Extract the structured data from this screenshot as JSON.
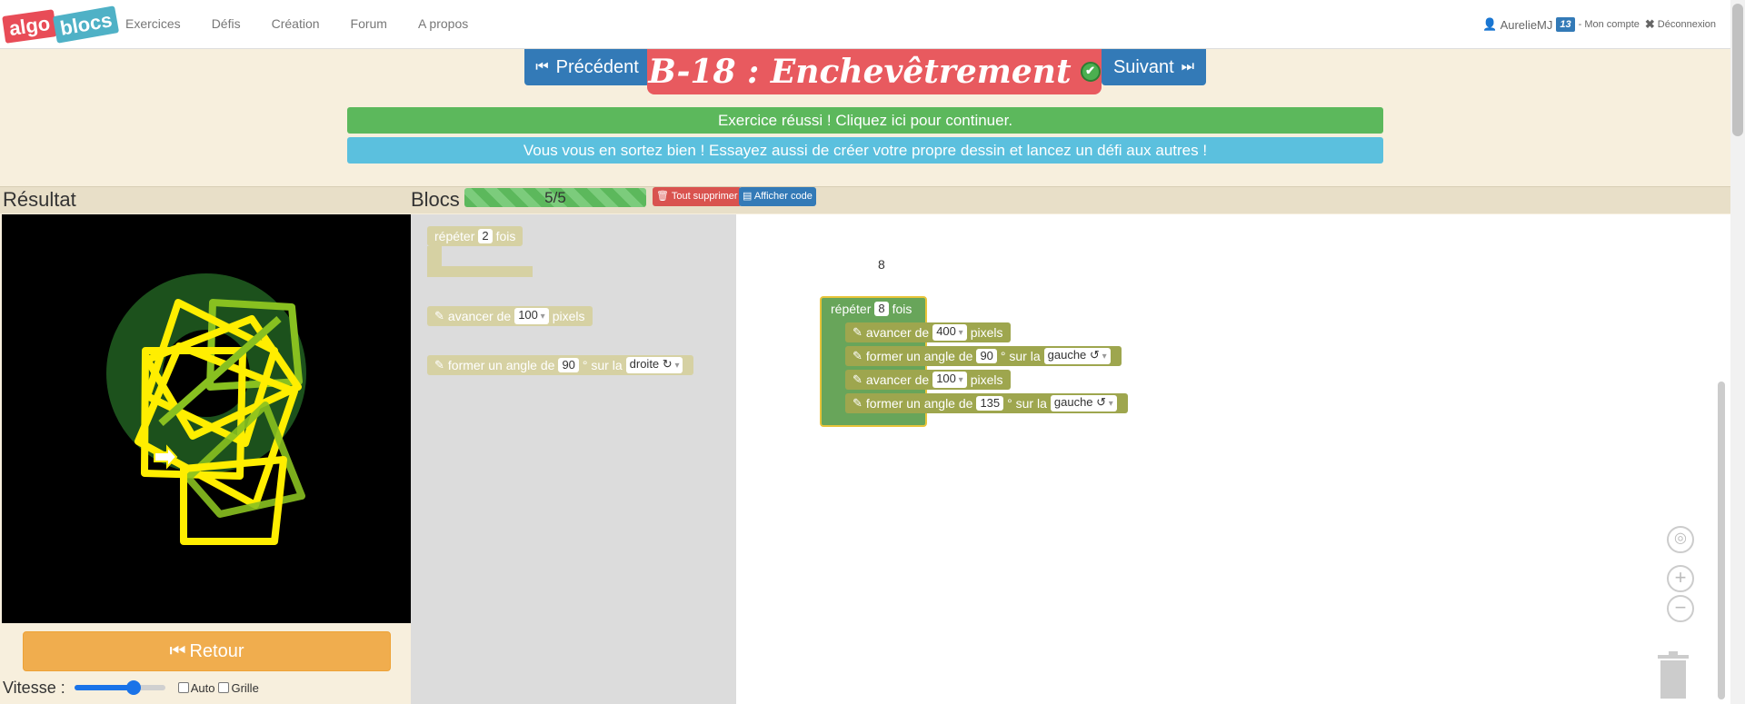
{
  "nav": {
    "logo_part1": "algo",
    "logo_part2": "blocs",
    "links": [
      "Exercices",
      "Défis",
      "Création",
      "Forum",
      "A propos"
    ],
    "user": "AurelieMJ",
    "level_badge": "13",
    "account": "- Mon compte",
    "logout": "Déconnexion"
  },
  "header": {
    "prev_label": "Précédent",
    "next_label": "Suivant",
    "title": "B-18 : Enchevêtrement",
    "success_banner": "Exercice réussi ! Cliquez ici pour continuer.",
    "info_banner": "Vous vous en sortez bien ! Essayez aussi de créer votre propre dessin et lancez un défi aux autres !"
  },
  "result": {
    "label": "Résultat",
    "retour_label": "Retour",
    "speed_label": "Vitesse :",
    "speed_level": 0.65,
    "auto_label": "Auto",
    "grid_label": "Grille"
  },
  "blocks": {
    "label": "Blocs",
    "progress_text": "5/5",
    "delete_all": "Tout supprimer",
    "show_code": "Afficher code"
  },
  "toolbox": {
    "repeat": {
      "prefix": "répéter",
      "value": "2",
      "suffix": "fois"
    },
    "forward": {
      "prefix": "avancer de",
      "value": "100",
      "suffix": "pixels"
    },
    "turn": {
      "prefix": "former un angle de",
      "value": "90",
      "mid": "° sur la",
      "dir": "droite ↻"
    }
  },
  "workspace": {
    "floating_text": "8",
    "repeat": {
      "prefix": "répéter",
      "value": "8",
      "suffix": "fois"
    },
    "steps": [
      {
        "prefix": "avancer de",
        "value": "400",
        "suffix": "pixels"
      },
      {
        "prefix": "former un angle de",
        "value": "90",
        "mid": "° sur la",
        "dir": "gauche ↺"
      },
      {
        "prefix": "avancer de",
        "value": "100",
        "suffix": "pixels"
      },
      {
        "prefix": "former un angle de",
        "value": "135",
        "mid": "° sur la",
        "dir": "gauche ↺"
      }
    ]
  },
  "colors": {
    "nav_blue": "#337ab7",
    "title_red": "#e85a5f",
    "success_green": "#5cb85c",
    "info_cyan": "#5bc0de",
    "retour_orange": "#f0ad4e",
    "drawing_yellow": "#ffee00",
    "drawing_green": "#88c020"
  }
}
